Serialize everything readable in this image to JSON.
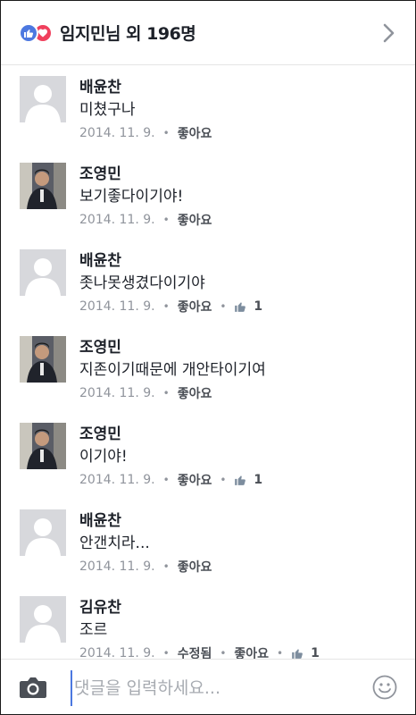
{
  "header": {
    "title": "임지민님 외 196명",
    "icons": [
      "like-reaction-icon",
      "love-reaction-icon",
      "chevron-right-icon"
    ],
    "colors": {
      "like": "#4c78e0",
      "love": "#f0405d"
    }
  },
  "comments": [
    {
      "author": "배윤찬",
      "text": "미쳤구나",
      "date": "2014. 11. 9.",
      "like_label": "좋아요",
      "likes": "",
      "avatar": "default-avatar"
    },
    {
      "author": "조영민",
      "text": "보기좋다이기야!",
      "date": "2014. 11. 9.",
      "like_label": "좋아요",
      "likes": "",
      "avatar": "photo-avatar"
    },
    {
      "author": "배윤찬",
      "text": "좃나못생겼다이기야",
      "date": "2014. 11. 9.",
      "like_label": "좋아요",
      "likes": "1",
      "avatar": "default-avatar"
    },
    {
      "author": "조영민",
      "text": "지존이기때문에 개안타이기여",
      "date": "2014. 11. 9.",
      "like_label": "좋아요",
      "likes": "",
      "avatar": "photo-avatar"
    },
    {
      "author": "조영민",
      "text": "이기야!",
      "date": "2014. 11. 9.",
      "like_label": "좋아요",
      "likes": "1",
      "avatar": "photo-avatar"
    },
    {
      "author": "배윤찬",
      "text": "안갠치라...",
      "date": "2014. 11. 9.",
      "like_label": "좋아요",
      "likes": "",
      "avatar": "default-avatar"
    },
    {
      "author": "김유찬",
      "text": "조르",
      "date": "2014. 11. 9.",
      "edited_label": "수정됨",
      "like_label": "좋아요",
      "likes": "1",
      "avatar": "default-avatar"
    }
  ],
  "footer": {
    "input_placeholder": "댓글을 입력하세요...",
    "icons": [
      "camera-icon",
      "smiley-icon"
    ]
  }
}
